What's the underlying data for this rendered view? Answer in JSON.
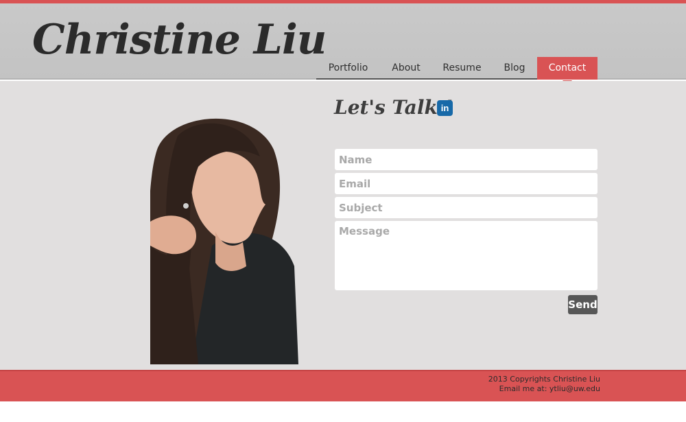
{
  "site": {
    "title": "Christine Liu"
  },
  "nav": {
    "items": [
      {
        "label": "Portfolio"
      },
      {
        "label": "About"
      },
      {
        "label": "Resume"
      },
      {
        "label": "Blog"
      },
      {
        "label": "Contact"
      }
    ],
    "active": "Contact"
  },
  "contact": {
    "heading": "Let's Talk !",
    "linkedin_label": "in",
    "linkedin_icon": "linkedin-icon",
    "name_placeholder": "Name",
    "email_placeholder": "Email",
    "subject_placeholder": "Subject",
    "message_placeholder": "Message",
    "send_label": "Send"
  },
  "footer": {
    "copyright": "2013 Copyrights Christine Liu",
    "email_line": "Email me at: ytliu@uw.edu"
  },
  "colors": {
    "accent": "#d95354",
    "header_bg": "#c6c6c6",
    "content_bg": "#e1dfdf",
    "linkedin": "#1769a8",
    "send_button": "#575757"
  }
}
